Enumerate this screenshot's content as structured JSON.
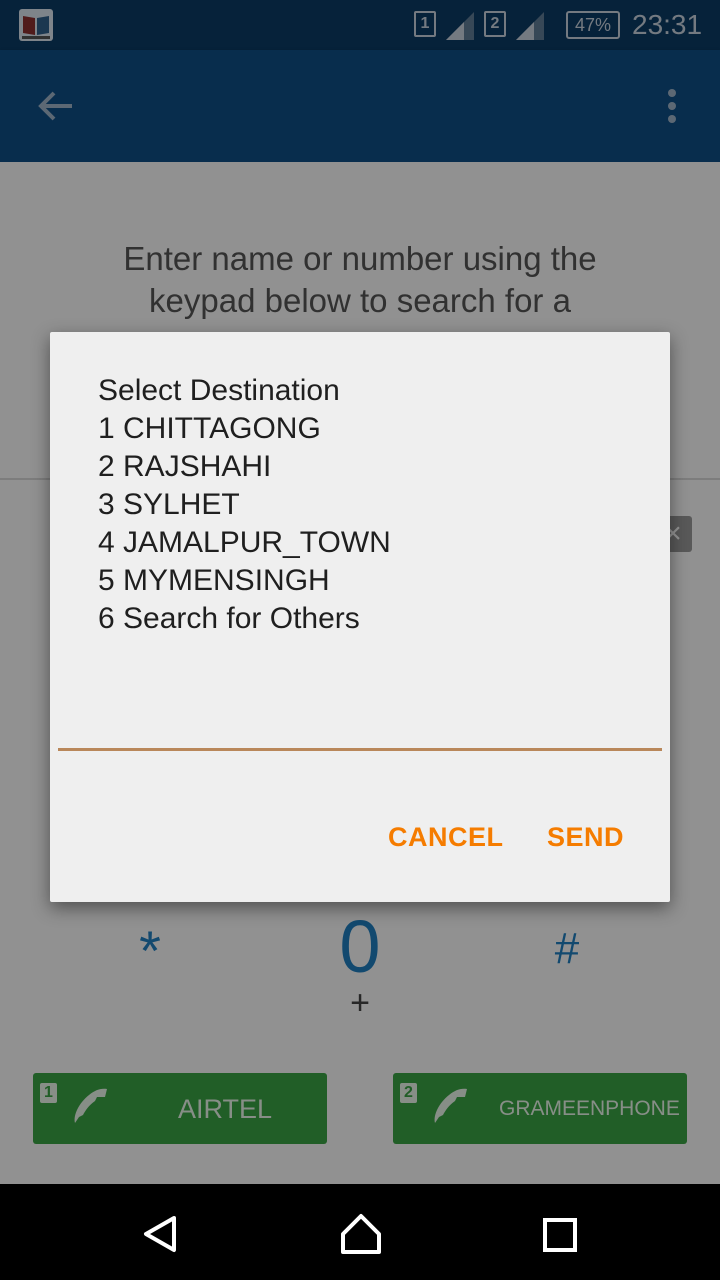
{
  "status_bar": {
    "sim1_label": "1",
    "sim2_label": "2",
    "battery_text": "47%",
    "time": "23:31",
    "app_icon": "book-icon"
  },
  "app_bar": {
    "back_icon": "arrow-back-icon",
    "menu_icon": "overflow-menu-icon"
  },
  "background": {
    "hint_line1": "Enter name or number using the",
    "hint_line2": "keypad below to search for a",
    "keys": {
      "star": "*",
      "zero": "0",
      "plus": "+",
      "hash": "#"
    },
    "sim_buttons": [
      {
        "slot": "1",
        "label": "AIRTEL"
      },
      {
        "slot": "2",
        "label": "GRAMEENPHONE"
      }
    ]
  },
  "dialog": {
    "message": "Select Destination\n1 CHITTAGONG\n2 RAJSHAHI\n3 SYLHET\n4 JAMALPUR_TOWN\n5 MYMENSINGH\n6 Search for Others",
    "input_value": "",
    "cancel_label": "CANCEL",
    "send_label": "SEND",
    "accent_color": "#f57c00"
  },
  "nav_bar": {
    "back": "back-triangle-icon",
    "home": "home-icon",
    "recents": "recents-square-icon"
  }
}
